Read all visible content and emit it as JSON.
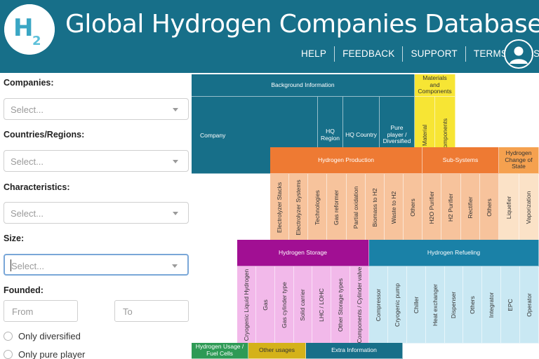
{
  "header": {
    "logo_text": "H2",
    "title": "Global Hydrogen Companies Database",
    "nav": [
      "HELP",
      "FEEDBACK",
      "SUPPORT",
      "TERMS OF USE"
    ],
    "colors": {
      "brand": "#176f89"
    }
  },
  "filters": {
    "companies": {
      "label": "Companies:",
      "placeholder": "Select..."
    },
    "countries": {
      "label": "Countries/Regions:",
      "placeholder": "Select..."
    },
    "characteristics": {
      "label": "Characteristics:",
      "placeholder": "Select..."
    },
    "size": {
      "label": "Size:",
      "placeholder": "Select..."
    },
    "founded": {
      "label": "Founded:",
      "from_placeholder": "From",
      "to_placeholder": "To"
    },
    "radios": [
      "Only diversified",
      "Only pure player"
    ]
  },
  "table": {
    "background": {
      "group": "Background Information",
      "company": "Company",
      "hq_region": "HQ Region",
      "hq_country": "HQ Country",
      "pure_player": "Pure player / Diversified",
      "color": "#176f89"
    },
    "materials": {
      "group": "Materials and Components",
      "cols": [
        "Material",
        "Components"
      ],
      "color": "#f7e534"
    },
    "production": {
      "group": "Hydrogen Production",
      "cols": [
        "Electrolyzer Stacks",
        "Electrolyzer Systems",
        "Technologies",
        "Gas reformer",
        "Partial oxidation",
        "Biomass to H2",
        "Waste to H2",
        "Others"
      ],
      "color": "#ee7a33"
    },
    "subsystems": {
      "group": "Sub-Systems",
      "cols": [
        "H2O Purifier",
        "H2 Purifier",
        "Rectifier",
        "Others"
      ],
      "color": "#ee7a33"
    },
    "change_of_state": {
      "group": "Hydrogen Change of State",
      "cols": [
        "Liquefier",
        "Vaporization"
      ],
      "color": "#f5a14f"
    },
    "storage": {
      "group": "Hydrogen Storage",
      "cols": [
        "Cryogenic Liquid Hydrogen",
        "Gas",
        "Gas cylinder type",
        "Solid carrier",
        "LHC / LOHC",
        "Other Storage types",
        "Components / Cylinder valve"
      ],
      "color": "#a10f93"
    },
    "refueling": {
      "group": "Hydrogen Refueling",
      "cols": [
        "Compressor",
        "Cryogenic pump",
        "Chiller",
        "Heat exchanger",
        "Dispenser",
        "Others",
        "Integrator",
        "EPC",
        "Operator"
      ],
      "color": "#1a81a7"
    },
    "bottom_groups": [
      {
        "label": "Hydrogen Usage / Fuel Cells",
        "color": "#2e9a55"
      },
      {
        "label": "Other usages",
        "color": "#d4b21a"
      },
      {
        "label": "Extra Information",
        "color": "#176f89"
      }
    ]
  }
}
